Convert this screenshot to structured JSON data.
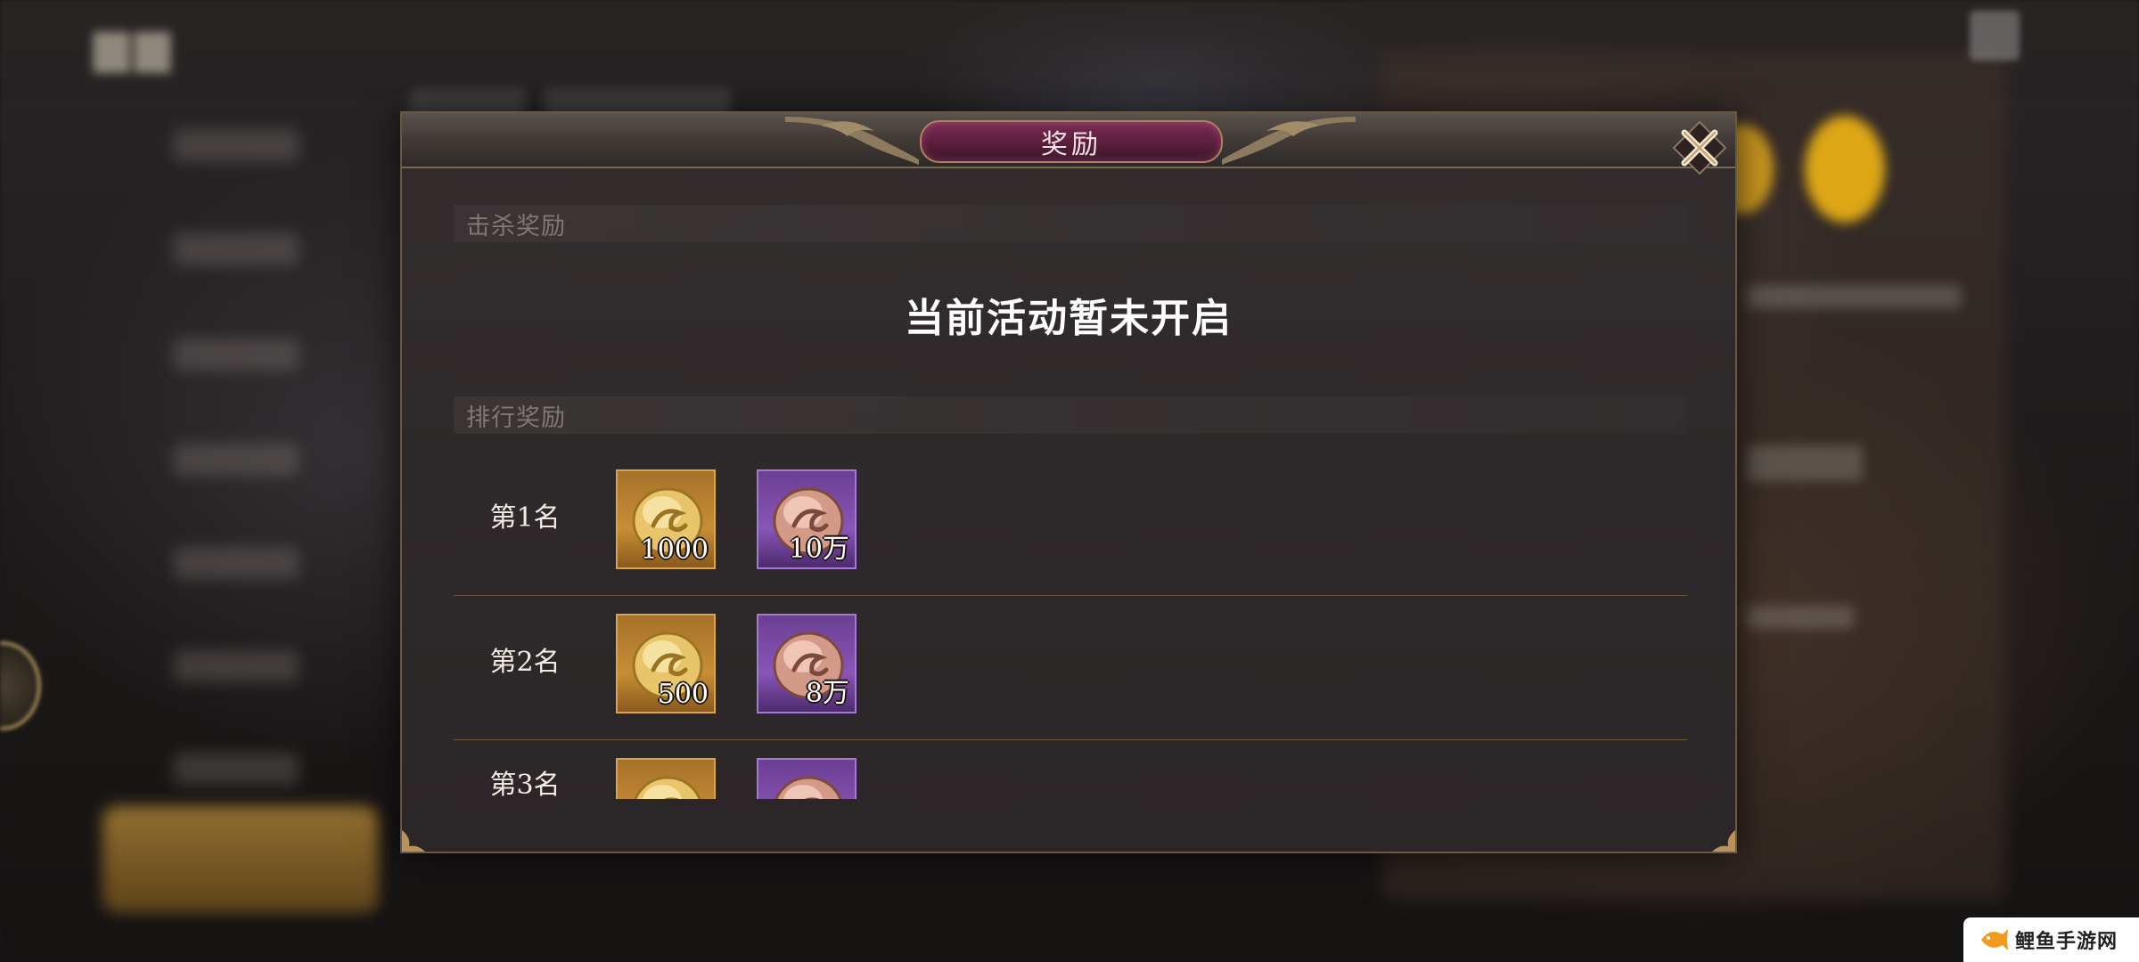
{
  "dialog": {
    "title": "奖励",
    "close_icon": "close-x-icon"
  },
  "kill_reward": {
    "section_label": "击杀奖励",
    "status_message": "当前活动暂未开启"
  },
  "rank_reward": {
    "section_label": "排行奖励",
    "rows": [
      {
        "rank_label": "第1名",
        "rewards": [
          {
            "icon": "gold-ingot-icon",
            "count": "1000",
            "frame": "gold"
          },
          {
            "icon": "copper-ingot-icon",
            "count": "10万",
            "frame": "purple"
          }
        ]
      },
      {
        "rank_label": "第2名",
        "rewards": [
          {
            "icon": "gold-ingot-icon",
            "count": "500",
            "frame": "gold"
          },
          {
            "icon": "copper-ingot-icon",
            "count": "8万",
            "frame": "purple"
          }
        ]
      },
      {
        "rank_label": "第3名",
        "rewards": [
          {
            "icon": "gold-ingot-icon",
            "count": "",
            "frame": "gold"
          },
          {
            "icon": "copper-ingot-icon",
            "count": "",
            "frame": "purple"
          }
        ]
      }
    ]
  },
  "watermark": {
    "text": "鲤鱼手游网",
    "icon": "carp-fish-icon"
  },
  "colors": {
    "title_plate": "#5a1e3c",
    "gold_frame": "#d7a64b",
    "purple_frame": "#a577d6",
    "divider": "#6b5a3c"
  }
}
